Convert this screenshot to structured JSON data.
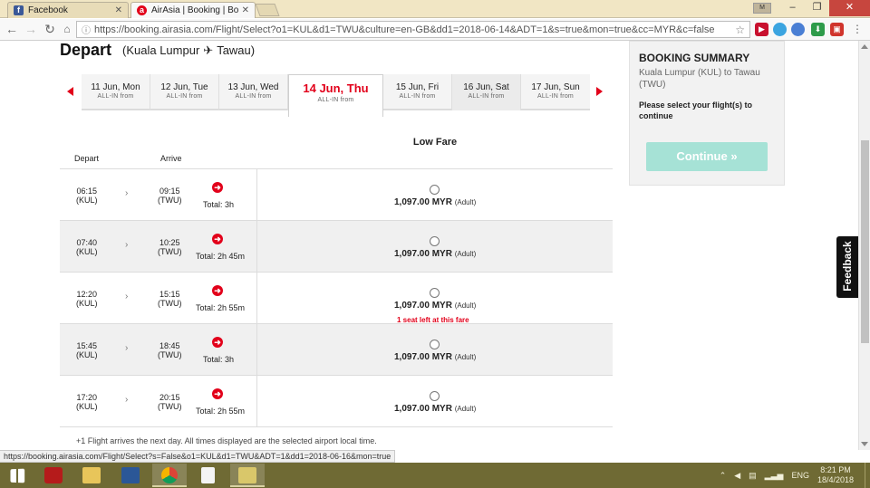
{
  "browser": {
    "tabs": [
      {
        "title": "Facebook",
        "icon": "facebook-icon",
        "active": false
      },
      {
        "title": "AirAsia | Booking | Book",
        "icon": "airasia-icon",
        "active": true
      }
    ],
    "profile_label": "M",
    "url": "https://booking.airasia.com/Flight/Select?o1=KUL&d1=TWU&culture=en-GB&dd1=2018-06-14&ADT=1&s=true&mon=true&cc=MYR&c=false",
    "status_url": "https://booking.airasia.com/Flight/Select?s=False&o1=KUL&d1=TWU&ADT=1&dd1=2018-06-16&mon=true"
  },
  "page": {
    "title": "Depart",
    "route_open": "(Kuala Lumpur",
    "route_plane": "✈",
    "route_close": "Tawau)"
  },
  "dates": [
    {
      "label": "11 Jun, Mon",
      "sub": "ALL-IN from"
    },
    {
      "label": "12 Jun, Tue",
      "sub": "ALL-IN from"
    },
    {
      "label": "13 Jun, Wed",
      "sub": "ALL-IN from"
    },
    {
      "label": "14 Jun, Thu",
      "sub": "ALL-IN from",
      "selected": true
    },
    {
      "label": "15 Jun, Fri",
      "sub": "ALL-IN from"
    },
    {
      "label": "16 Jun, Sat",
      "sub": "ALL-IN from"
    },
    {
      "label": "17 Jun, Sun",
      "sub": "ALL-IN from"
    }
  ],
  "table": {
    "fare_header": "Low Fare",
    "col_depart": "Depart",
    "col_arrive": "Arrive"
  },
  "flights": [
    {
      "dep_time": "06:15",
      "dep_code": "(KUL)",
      "arr_time": "09:15",
      "arr_code": "(TWU)",
      "total": "Total: 3h",
      "price": "1,097.00 MYR",
      "pax": "(Adult)",
      "seats": ""
    },
    {
      "dep_time": "07:40",
      "dep_code": "(KUL)",
      "arr_time": "10:25",
      "arr_code": "(TWU)",
      "total": "Total: 2h 45m",
      "price": "1,097.00 MYR",
      "pax": "(Adult)",
      "seats": ""
    },
    {
      "dep_time": "12:20",
      "dep_code": "(KUL)",
      "arr_time": "15:15",
      "arr_code": "(TWU)",
      "total": "Total: 2h 55m",
      "price": "1,097.00 MYR",
      "pax": "(Adult)",
      "seats": "1 seat left at this fare"
    },
    {
      "dep_time": "15:45",
      "dep_code": "(KUL)",
      "arr_time": "18:45",
      "arr_code": "(TWU)",
      "total": "Total: 3h",
      "price": "1,097.00 MYR",
      "pax": "(Adult)",
      "seats": ""
    },
    {
      "dep_time": "17:20",
      "dep_code": "(KUL)",
      "arr_time": "20:15",
      "arr_code": "(TWU)",
      "total": "Total: 2h 55m",
      "price": "1,097.00 MYR",
      "pax": "(Adult)",
      "seats": ""
    }
  ],
  "footnote": "+1 Flight arrives the next day. All times displayed are the selected airport local time.",
  "summary": {
    "heading": "BOOKING SUMMARY",
    "route": "Kuala Lumpur (KUL) to Tawau (TWU)",
    "note": "Please select your flight(s) to continue",
    "continue_label": "Continue »"
  },
  "feedback_label": "Feedback",
  "taskbar": {
    "language": "ENG",
    "time": "8:21 PM",
    "date": "18/4/2018"
  },
  "colors": {
    "brand_red": "#e2001a",
    "continue_disabled": "#a6e2d6",
    "taskbar": "#6f6a34"
  }
}
